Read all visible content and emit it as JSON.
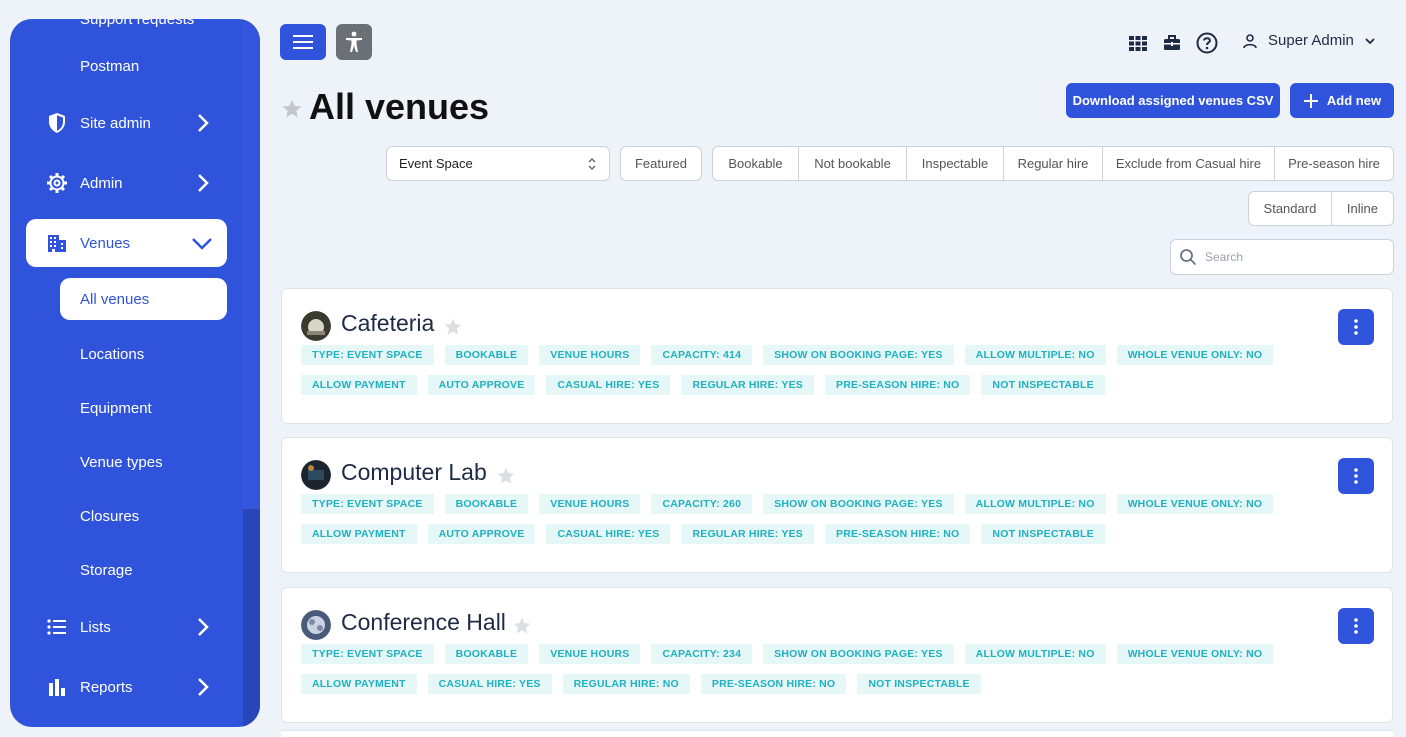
{
  "sidebar": {
    "cut_top_label": "Support requests",
    "postman": "Postman",
    "site_admin": "Site admin",
    "admin": "Admin",
    "venues": "Venues",
    "sub_items": [
      "All venues",
      "Locations",
      "Equipment",
      "Venue types",
      "Closures",
      "Storage"
    ],
    "lists": "Lists",
    "reports": "Reports"
  },
  "header": {
    "user_name": "Super Admin"
  },
  "page": {
    "title": "All venues",
    "download_csv": "Download assigned venues CSV",
    "add_new": "Add new"
  },
  "filters": {
    "type_select": "Event Space",
    "featured": "Featured",
    "group1": [
      "Bookable",
      "Not bookable",
      "Inspectable",
      "Regular hire",
      "Exclude from Casual hire",
      "Pre-season hire"
    ],
    "view_modes": [
      "Standard",
      "Inline"
    ],
    "search_placeholder": "Search"
  },
  "venues": [
    {
      "name": "Cafeteria",
      "tags": [
        "TYPE: EVENT SPACE",
        "BOOKABLE",
        "VENUE HOURS",
        "CAPACITY: 414",
        "SHOW ON BOOKING PAGE: YES",
        "ALLOW MULTIPLE: NO",
        "WHOLE VENUE ONLY: NO",
        "ALLOW PAYMENT",
        "AUTO APPROVE",
        "CASUAL HIRE: YES",
        "REGULAR HIRE: YES",
        "PRE-SEASON HIRE: NO",
        "NOT INSPECTABLE"
      ]
    },
    {
      "name": "Computer Lab",
      "tags": [
        "TYPE: EVENT SPACE",
        "BOOKABLE",
        "VENUE HOURS",
        "CAPACITY: 260",
        "SHOW ON BOOKING PAGE: YES",
        "ALLOW MULTIPLE: NO",
        "WHOLE VENUE ONLY: NO",
        "ALLOW PAYMENT",
        "AUTO APPROVE",
        "CASUAL HIRE: YES",
        "REGULAR HIRE: YES",
        "PRE-SEASON HIRE: NO",
        "NOT INSPECTABLE"
      ]
    },
    {
      "name": "Conference Hall",
      "tags": [
        "TYPE: EVENT SPACE",
        "BOOKABLE",
        "VENUE HOURS",
        "CAPACITY: 234",
        "SHOW ON BOOKING PAGE: YES",
        "ALLOW MULTIPLE: NO",
        "WHOLE VENUE ONLY: NO",
        "ALLOW PAYMENT",
        "CASUAL HIRE: YES",
        "REGULAR HIRE: NO",
        "PRE-SEASON HIRE: NO",
        "NOT INSPECTABLE"
      ]
    }
  ],
  "colors": {
    "primary": "#2f54db",
    "tag_bg": "#e6f7f7",
    "tag_text": "#20b0c0",
    "page_bg": "#eef2f9"
  }
}
